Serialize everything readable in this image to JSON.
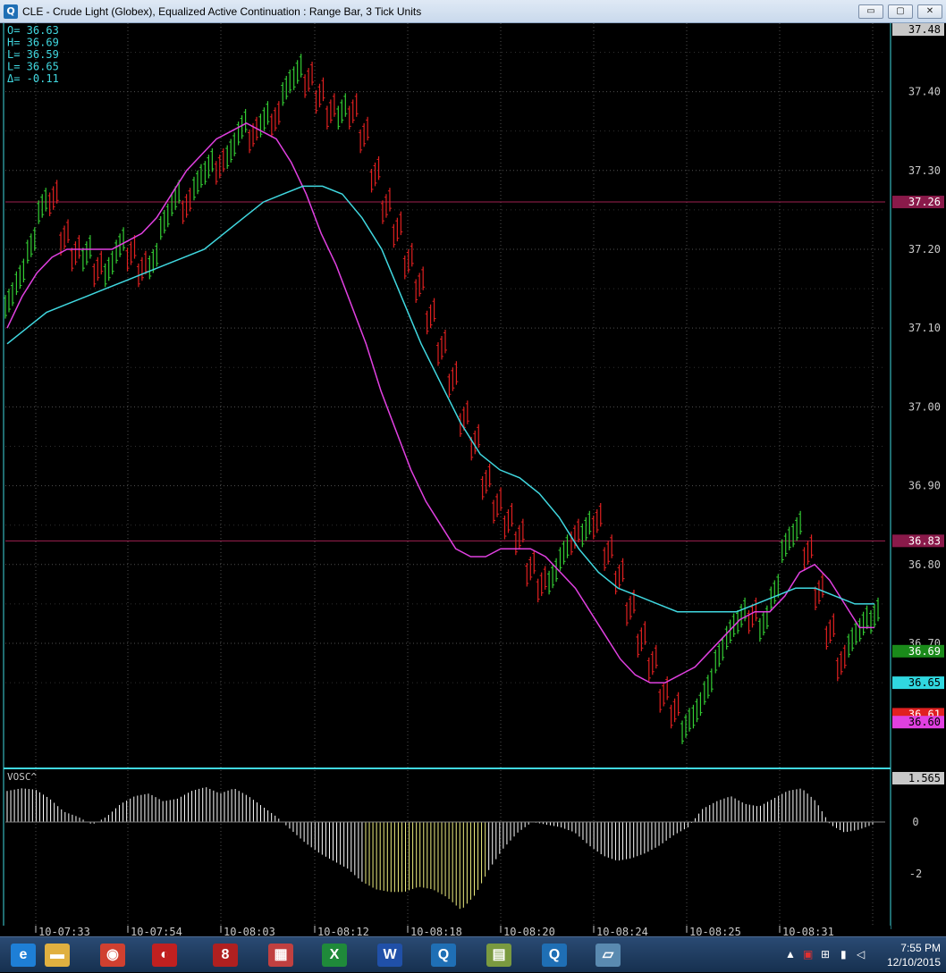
{
  "window": {
    "title": "CLE - Crude Light (Globex), Equalized Active Continuation : Range Bar, 3 Tick Units",
    "app_icon_label": "Q",
    "minimize_label": "▭",
    "maximize_label": "▢",
    "close_label": "✕"
  },
  "colors": {
    "up_bar": "#33cc33",
    "down_bar": "#e02020",
    "ma_fast": "#e040e0",
    "ma_slow": "#40d8e0",
    "hline": "#a02050",
    "grid": "#505050",
    "axis_text": "#c8c8c8",
    "osc_pos": "#ffffff",
    "osc_neg_hi": "#f0f080",
    "separator": "#40d8e0"
  },
  "readout": {
    "lines": [
      "O=  36.63",
      "H=  36.69",
      "L=  36.59",
      "L=  36.65",
      "Δ=  -0.11"
    ]
  },
  "price_axis": {
    "ticks": [
      "37.40",
      "37.30",
      "37.20",
      "37.10",
      "37.00",
      "36.90",
      "36.80",
      "36.70"
    ],
    "tick_values": [
      37.4,
      37.3,
      37.2,
      37.1,
      37.0,
      36.9,
      36.8,
      36.7
    ],
    "top_label": "37.48",
    "badges": [
      {
        "value": 37.26,
        "label": "37.26",
        "bg": "#8a1a4a",
        "fg": "#ffffff"
      },
      {
        "value": 36.83,
        "label": "36.83",
        "bg": "#8a1a4a",
        "fg": "#ffffff"
      },
      {
        "value": 36.69,
        "label": "36.69",
        "bg": "#1a8a1a",
        "fg": "#ffffff"
      },
      {
        "value": 36.65,
        "label": "36.65",
        "bg": "#30d8e0",
        "fg": "#000000"
      },
      {
        "value": 36.61,
        "label": "36.61",
        "bg": "#e02020",
        "fg": "#ffffff"
      },
      {
        "value": 36.6,
        "label": "36.60",
        "bg": "#e040e0",
        "fg": "#000000"
      }
    ],
    "range": [
      36.535,
      37.48
    ]
  },
  "hlines": [
    37.26,
    36.83
  ],
  "time_axis": {
    "labels": [
      "10-07:33",
      "10-07:54",
      "10-08:03",
      "10-08:12",
      "10-08:18",
      "10-08:20",
      "10-08:24",
      "10-08:25",
      "10-08:31"
    ]
  },
  "oscillator": {
    "title": "VOSC^",
    "top_label": "1.565",
    "ticks": [
      "0",
      "-2"
    ],
    "tick_values": [
      0,
      -2
    ],
    "range": [
      -3.6,
      1.565
    ]
  },
  "chart_data": {
    "type": "range-bar",
    "title": "CLE - Crude Light (Globex), Equalized Active Continuation : Range Bar, 3 Tick Units",
    "ylim": [
      36.535,
      37.48
    ],
    "closes": [
      37.15,
      37.18,
      37.22,
      37.27,
      37.25,
      37.2,
      37.18,
      37.21,
      37.16,
      37.19,
      37.22,
      37.18,
      37.16,
      37.2,
      37.25,
      37.28,
      37.24,
      37.3,
      37.32,
      37.29,
      37.34,
      37.37,
      37.33,
      37.38,
      37.35,
      37.42,
      37.44,
      37.4,
      37.38,
      37.36,
      37.39,
      37.36,
      37.33,
      37.28,
      37.24,
      37.21,
      37.17,
      37.14,
      37.1,
      37.06,
      37.02,
      36.97,
      36.94,
      36.89,
      36.86,
      36.84,
      36.82,
      36.78,
      36.76,
      36.8,
      36.83,
      36.82,
      36.86,
      36.84,
      36.8,
      36.77,
      36.73,
      36.69,
      36.66,
      36.62,
      36.6,
      36.61,
      36.63,
      36.66,
      36.7,
      36.73,
      36.75,
      36.72,
      36.74,
      36.78,
      36.84,
      36.86,
      36.8,
      36.75,
      36.7,
      36.66,
      36.72,
      36.74,
      36.75
    ],
    "ma_fast": [
      37.1,
      37.14,
      37.17,
      37.19,
      37.2,
      37.2,
      37.2,
      37.2,
      37.21,
      37.22,
      37.24,
      37.27,
      37.3,
      37.32,
      37.34,
      37.35,
      37.36,
      37.35,
      37.34,
      37.31,
      37.27,
      37.22,
      37.18,
      37.13,
      37.08,
      37.02,
      36.97,
      36.92,
      36.88,
      36.85,
      36.82,
      36.81,
      36.81,
      36.82,
      36.82,
      36.82,
      36.81,
      36.79,
      36.77,
      36.74,
      36.71,
      36.68,
      36.66,
      36.65,
      36.65,
      36.66,
      36.67,
      36.69,
      36.71,
      36.73,
      36.74,
      36.74,
      36.76,
      36.79,
      36.8,
      36.78,
      36.75,
      36.72,
      36.72
    ],
    "ma_slow": [
      37.08,
      37.1,
      37.12,
      37.13,
      37.14,
      37.15,
      37.16,
      37.17,
      37.18,
      37.19,
      37.2,
      37.22,
      37.24,
      37.26,
      37.27,
      37.28,
      37.28,
      37.27,
      37.24,
      37.2,
      37.14,
      37.08,
      37.03,
      36.98,
      36.94,
      36.92,
      36.91,
      36.89,
      36.86,
      36.82,
      36.79,
      36.77,
      36.76,
      36.75,
      36.74,
      36.74,
      36.74,
      36.74,
      36.75,
      36.76,
      36.77,
      36.77,
      36.76,
      36.75,
      36.75
    ],
    "osc_values": [
      1.2,
      1.3,
      1.25,
      0.9,
      0.4,
      0.2,
      -0.1,
      0.2,
      0.7,
      1.0,
      1.1,
      0.8,
      0.9,
      1.2,
      1.35,
      1.1,
      1.3,
      1.0,
      0.6,
      0.2,
      -0.3,
      -0.8,
      -1.2,
      -1.5,
      -1.8,
      -2.3,
      -2.6,
      -2.7,
      -2.7,
      -2.5,
      -2.6,
      -2.9,
      -3.4,
      -2.8,
      -1.8,
      -1.0,
      -0.4,
      0.0,
      -0.1,
      -0.2,
      -0.4,
      -0.9,
      -1.3,
      -1.5,
      -1.4,
      -1.2,
      -0.9,
      -0.5,
      -0.2,
      0.5,
      0.8,
      1.0,
      0.7,
      0.6,
      0.9,
      1.2,
      1.3,
      0.8,
      -0.1,
      -0.4,
      -0.3,
      -0.1
    ],
    "grid": true
  },
  "taskbar": {
    "apps": [
      {
        "label": "e",
        "bg": "#1e7fd6"
      },
      {
        "label": "▬",
        "bg": "#e0b040"
      },
      {
        "label": "◉",
        "bg": "#d04030"
      },
      {
        "label": "◐",
        "bg": "#c02020"
      },
      {
        "label": "8",
        "bg": "#b02020"
      },
      {
        "label": "▦",
        "bg": "#c04040"
      },
      {
        "label": "X",
        "bg": "#1f8a3a"
      },
      {
        "label": "W",
        "bg": "#2050a8"
      },
      {
        "label": "Q",
        "bg": "#1f6fb5"
      },
      {
        "label": "▤",
        "bg": "#7a9a40"
      },
      {
        "label": "Q",
        "bg": "#1f6fb5"
      },
      {
        "label": "▱",
        "bg": "#5a8ab0"
      }
    ],
    "time": "7:55 PM",
    "date": "12/10/2015"
  }
}
